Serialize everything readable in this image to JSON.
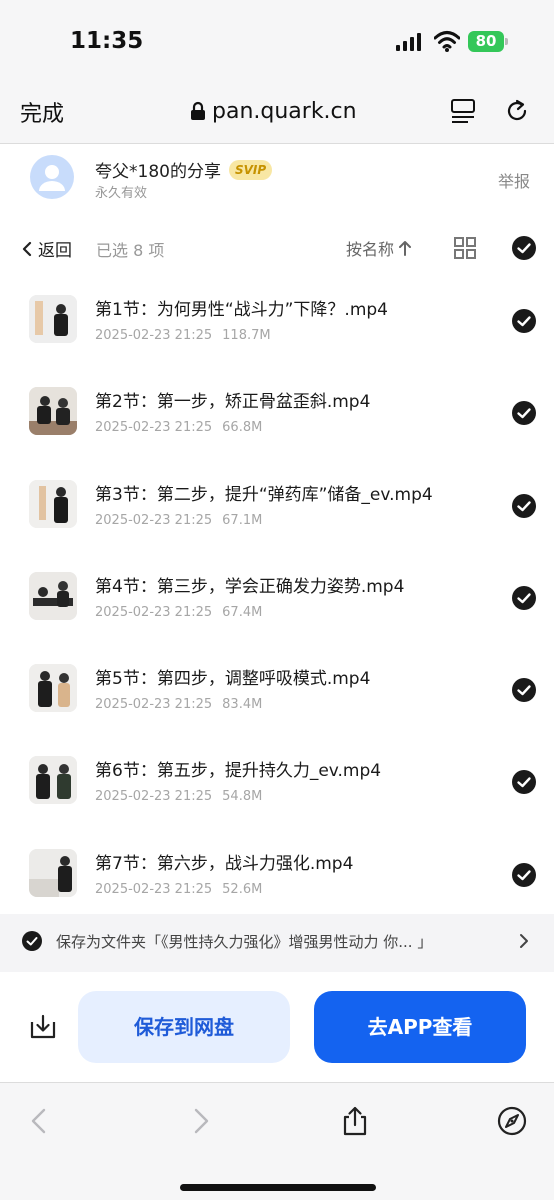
{
  "status_bar": {
    "time": "11:35",
    "battery": "80"
  },
  "nav": {
    "done_label": "完成",
    "url": "pan.quark.cn"
  },
  "share": {
    "title": "夸父*180的分享",
    "badge": "SVIP",
    "subtitle": "永久有效",
    "report_label": "举报"
  },
  "toolbar": {
    "back_label": "返回",
    "selected_text": "已选 8 项",
    "sort_label": "按名称"
  },
  "files": [
    {
      "name": "第1节：为何男性“战斗力”下降？.mp4",
      "date": "2025-02-23 21:25",
      "size": "118.7M"
    },
    {
      "name": "第2节：第一步，矫正骨盆歪斜.mp4",
      "date": "2025-02-23 21:25",
      "size": "66.8M"
    },
    {
      "name": "第3节：第二步，提升“弹药库”储备_ev.mp4",
      "date": "2025-02-23 21:25",
      "size": "67.1M"
    },
    {
      "name": "第4节：第三步，学会正确发力姿势.mp4",
      "date": "2025-02-23 21:25",
      "size": "67.4M"
    },
    {
      "name": "第5节：第四步，调整呼吸模式.mp4",
      "date": "2025-02-23 21:25",
      "size": "83.4M"
    },
    {
      "name": "第6节：第五步，提升持久力_ev.mp4",
      "date": "2025-02-23 21:25",
      "size": "54.8M"
    },
    {
      "name": "第7节：第六步，战斗力强化.mp4",
      "date": "2025-02-23 21:25",
      "size": "52.6M"
    }
  ],
  "save_folder": {
    "text": "保存为文件夹「《男性持久力强化》增强男性动力 你... 」"
  },
  "actions": {
    "save_label": "保存到网盘",
    "open_app_label": "去APP查看"
  },
  "colors": {
    "primary": "#1463f0",
    "primary_light": "#e6efff",
    "svip_bg": "#f8e7a4",
    "battery": "#34c759"
  },
  "icons": [
    "lock-icon",
    "reader-icon",
    "reload-icon",
    "avatar-icon",
    "chevron-left-icon",
    "sort-arrow-icon",
    "grid-icon",
    "check-circle-icon",
    "download-icon",
    "back-arrow-icon",
    "forward-arrow-icon",
    "share-icon",
    "compass-icon"
  ]
}
